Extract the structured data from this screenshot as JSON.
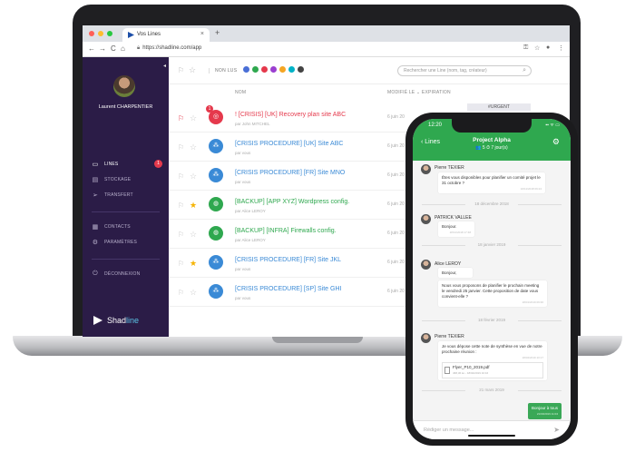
{
  "browser": {
    "tab_title": "Vos Lines",
    "tab_close": "×",
    "new_tab": "+",
    "url": "https://shadline.com/app",
    "nav": {
      "back": "←",
      "forward": "→",
      "reload": "C",
      "home": "⌂"
    },
    "tools": {
      "key": "⚿",
      "star": "☆",
      "account": "●",
      "menu": "⋮"
    },
    "dot_colors": [
      "#ff5f57",
      "#febc2e",
      "#28c840"
    ]
  },
  "sidebar": {
    "user_name": "Laurent CHARPENTIER",
    "collapse": "◂",
    "items": [
      {
        "label": "LINES",
        "icon": "lines-icon",
        "glyph": "▭",
        "badge": "1"
      },
      {
        "label": "STOCKAGE",
        "icon": "storage-icon",
        "glyph": "▤"
      },
      {
        "label": "TRANSFERT",
        "icon": "send-icon",
        "glyph": "➢"
      },
      {
        "label": "CONTACTS",
        "icon": "contacts-icon",
        "glyph": "▦"
      },
      {
        "label": "PARAMÈTRES",
        "icon": "settings-icon",
        "glyph": "⚙"
      },
      {
        "label": "DÉCONNEXION",
        "icon": "logout-icon",
        "glyph": "⏻"
      }
    ],
    "brand": {
      "part1": "Shad",
      "part2": "line"
    }
  },
  "toolbar": {
    "flag": "⚐",
    "star": "☆",
    "unread_label": "NON LUS",
    "colors": [
      "#4a6fd6",
      "#2fa84f",
      "#e5394c",
      "#9b3fd0",
      "#f5a623",
      "#00b3c7",
      "#444444"
    ],
    "search_placeholder": "Rechercher une Line (nom, tag, créateur)",
    "search_icon": "⌕"
  },
  "list": {
    "col_name": "NOM",
    "col_modified": "MODIFIÉ LE ⌄ EXPIRATION",
    "urgent_tag": "#URGENT",
    "rows": [
      {
        "title": "! [CRISIS] [UK] Recovery plan site ABC",
        "by": "par John MITCHEL",
        "date": "6 juin 20",
        "flag": "red",
        "star": false,
        "circle_color": "#e5394c",
        "circle_glyph": "◎",
        "title_color": "#e5394c",
        "badge": "1"
      },
      {
        "title": "[CRISIS PROCEDURE] [UK] Site ABC",
        "by": "par vous",
        "date": "6 juin 20",
        "flag": "none",
        "star": false,
        "circle_color": "#3a8ad6",
        "circle_glyph": "⁂",
        "title_color": "#3a8ad6"
      },
      {
        "title": "[CRISIS PROCEDURE] [FR] Site MNO",
        "by": "par vous",
        "date": "6 juin 20",
        "flag": "none",
        "star": false,
        "circle_color": "#3a8ad6",
        "circle_glyph": "⁂",
        "title_color": "#3a8ad6"
      },
      {
        "title": "[BACKUP] [APP XYZ] Wordpress config.",
        "by": "par Alice LEROY",
        "date": "6 juin 20",
        "flag": "none",
        "star": true,
        "circle_color": "#2fa84f",
        "circle_glyph": "◍",
        "title_color": "#2fa84f"
      },
      {
        "title": "[BACKUP] [INFRA] Firewalls config.",
        "by": "par Alice LEROY",
        "date": "6 juin 20",
        "flag": "none",
        "star": false,
        "circle_color": "#2fa84f",
        "circle_glyph": "◍",
        "title_color": "#2fa84f"
      },
      {
        "title": "[CRISIS PROCEDURE] [FR] Site JKL",
        "by": "par vous",
        "date": "6 juin 20",
        "flag": "none",
        "star": true,
        "circle_color": "#3a8ad6",
        "circle_glyph": "⁂",
        "title_color": "#3a8ad6"
      },
      {
        "title": "[CRISIS PROCEDURE] [SP] Site GHI",
        "by": "par vous",
        "date": "6 juin 20",
        "flag": "none",
        "star": false,
        "circle_color": "#3a8ad6",
        "circle_glyph": "⁂",
        "title_color": "#3a8ad6"
      }
    ]
  },
  "phone": {
    "time": "12:20",
    "status": "▪▪ ᯤ ▭",
    "back_label": "‹ Lines",
    "title": "Project Alpha",
    "subtitle": "👥 5   ⏱ 7 jour(s)",
    "gear": "⚙",
    "messages": [
      {
        "author": "Pierre TEXIER",
        "text": "Êtes vous disponibles pour planifier un comité projet le 31 octobre ?",
        "ts": "16/11/2018 09:24"
      },
      {
        "divider": "18 décembre 2018"
      },
      {
        "author": "PATRICK VALLEE",
        "text": "Bonjour.",
        "ts": "18/12/2018 17:48"
      },
      {
        "divider": "18 janvier 2019"
      },
      {
        "author": "Alice LEROY",
        "text1": "Bonjour,",
        "text2": "Nous vous proposons de planifier le prochain meeting le vendredi 25 janvier. Cette proposition de date vous convient-elle ?",
        "ts": "18/01/2019 09:36"
      },
      {
        "divider": "18 février 2019"
      },
      {
        "author": "Pierre TEXIER",
        "text": "Je vous dépose cette note de synthèse en vue de notre prochaine réunion :",
        "file_name": "Flyer_P10_2019.pdf",
        "file_meta": "468,36 ko - 18/02/2019 10:16",
        "ts": "18/02/2019 10:17"
      },
      {
        "divider": "21 mars 2019"
      }
    ],
    "my_message": "Bonjour à tous",
    "my_ts": "21/03/2019 11:04",
    "input_placeholder": "Rédiger un message...",
    "send": "➤"
  }
}
